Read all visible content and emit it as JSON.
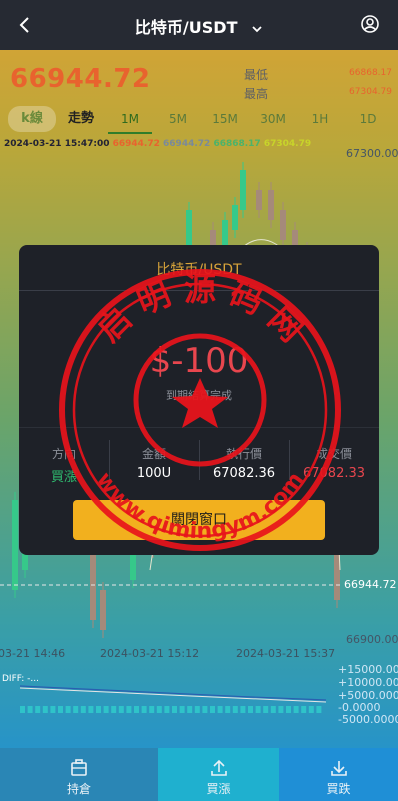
{
  "header": {
    "title": "比特币/USDT",
    "back_icon": "chevron-left-icon",
    "menu_icon": "chevron-down-icon",
    "user_icon": "user-circle-icon"
  },
  "ticker": {
    "price": "66944.72",
    "low_label": "最低",
    "low_value": "66868.17",
    "high_label": "最高",
    "high_value": "67304.79"
  },
  "tabs": [
    "k線",
    "走勢",
    "1M",
    "5M",
    "15M",
    "30M",
    "1H",
    "1D"
  ],
  "active_tab": "1M",
  "ohlc_line": {
    "time": "2024-03-21 15:47:00",
    "open": "66944.72",
    "high": "66944.72",
    "low": "66868.17",
    "close": "67304.79"
  },
  "axis": {
    "top": "67300.00",
    "mid": "66944.72",
    "bottom": "66900.00"
  },
  "times": [
    "03-21 14:46",
    "2024-03-21 15:12",
    "2024-03-21 15:37"
  ],
  "indicator": {
    "label": "DIFF: -...",
    "macd_levels": [
      "+15000.000",
      "+10000.000",
      "+5000.000",
      "-0.0000",
      "-5000.0000"
    ]
  },
  "modal": {
    "title": "比特币/USDT",
    "amount": "$-100",
    "subtitle": "到期結算完成",
    "stats": [
      {
        "label": "方向",
        "value": "買漲",
        "color": "#2fbf71"
      },
      {
        "label": "金額",
        "value": "100U",
        "color": "#ffffff"
      },
      {
        "label": "執行價",
        "value": "67082.36",
        "color": "#ffffff"
      },
      {
        "label": "成交價",
        "value": "67082.33",
        "color": "#e8464e"
      }
    ],
    "confirm": "關閉窗口"
  },
  "stamp": {
    "top_text": "启 明 源 码 网",
    "bottom_text": "www.qimingym.com",
    "color": "#e8141b"
  },
  "bottom_nav": [
    {
      "label": "持倉",
      "icon": "briefcase-icon"
    },
    {
      "label": "買漲",
      "icon": "upload-icon"
    },
    {
      "label": "買跌",
      "icon": "download-icon"
    }
  ],
  "colors": {
    "accent": "#e8632e",
    "rise": "#36c98a",
    "fall": "#e04b4b",
    "button": "#f2b01e"
  }
}
